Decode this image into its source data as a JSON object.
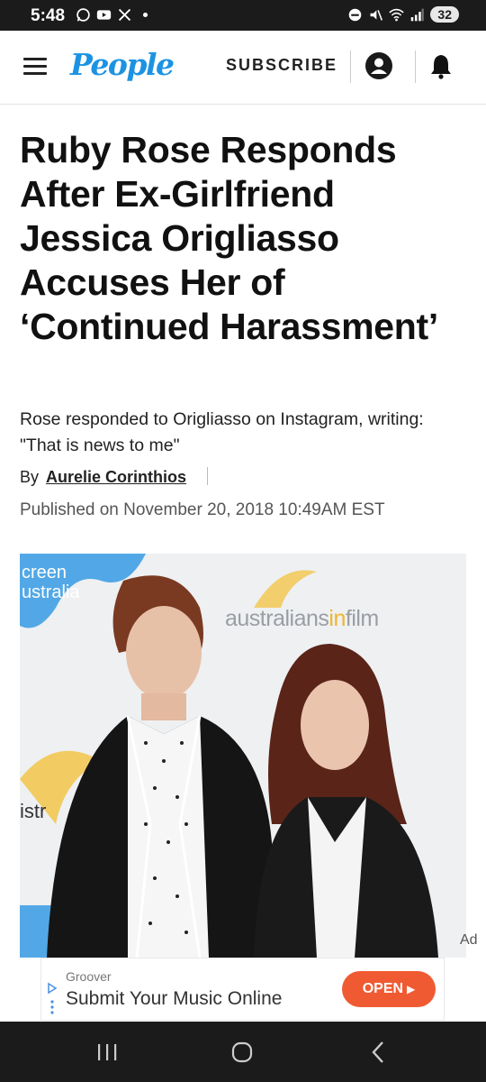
{
  "status_bar": {
    "time": "5:48",
    "battery": "32",
    "left_icons": [
      "whatsapp-icon",
      "youtube-icon",
      "x-icon",
      "dot-icon"
    ],
    "right_icons": [
      "dnd-icon",
      "mute-icon",
      "wifi-icon",
      "signal-icon"
    ]
  },
  "header": {
    "logo": "People",
    "subscribe": "SUBSCRIBE"
  },
  "article": {
    "title": "Ruby Rose Responds After Ex-Girlfriend Jessica Origliasso Accuses Her of ‘Continued Harassment’",
    "dek": "Rose responded to Origliasso on Instagram, writing: \"That is news to me\"",
    "by": "By",
    "author": "Aurelie Corinthios",
    "published": "Published on November 20, 2018 10:49AM EST"
  },
  "photo": {
    "watermark_left": "creen\nustralia",
    "watermark_right_a": "australians",
    "watermark_right_b": "in",
    "watermark_right_c": "film",
    "watermark_mid": "istr"
  },
  "ad": {
    "label": "Ad",
    "sponsor": "Groover",
    "headline": "Submit Your Music Online",
    "cta": "OPEN"
  },
  "colors": {
    "brand": "#1c93e2",
    "cta": "#f05a32",
    "bars": "#1b1b1b"
  }
}
